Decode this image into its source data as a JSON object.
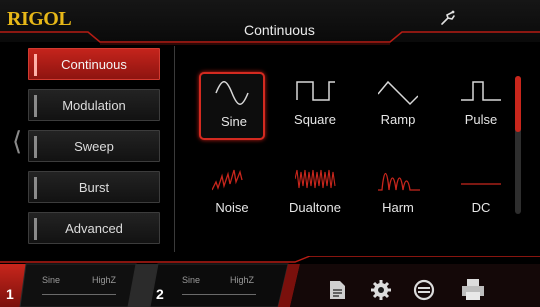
{
  "header": {
    "logo": "RIGOL",
    "title": "Continuous",
    "usb_icon": "usb-icon"
  },
  "menu": {
    "items": [
      {
        "label": "Continuous",
        "active": true
      },
      {
        "label": "Modulation",
        "active": false
      },
      {
        "label": "Sweep",
        "active": false
      },
      {
        "label": "Burst",
        "active": false
      },
      {
        "label": "Advanced",
        "active": false
      }
    ],
    "back_icon": "chevron-left-icon"
  },
  "waveforms": [
    {
      "label": "Sine",
      "icon": "sine-wave-icon",
      "selected": true
    },
    {
      "label": "Square",
      "icon": "square-wave-icon",
      "selected": false
    },
    {
      "label": "Ramp",
      "icon": "ramp-wave-icon",
      "selected": false
    },
    {
      "label": "Pulse",
      "icon": "pulse-wave-icon",
      "selected": false
    },
    {
      "label": "Noise",
      "icon": "noise-wave-icon",
      "selected": false
    },
    {
      "label": "Dualtone",
      "icon": "dualtone-wave-icon",
      "selected": false
    },
    {
      "label": "Harm",
      "icon": "harmonic-wave-icon",
      "selected": false
    },
    {
      "label": "DC",
      "icon": "dc-wave-icon",
      "selected": false
    }
  ],
  "scroll_position": 0.4,
  "channels": [
    {
      "number": "1",
      "waveform": "Sine",
      "impedance": "HighZ",
      "active": true
    },
    {
      "number": "2",
      "waveform": "Sine",
      "impedance": "HighZ",
      "active": false
    }
  ],
  "footer_icons": [
    "document-icon",
    "gear-icon",
    "sync-icon",
    "printer-icon"
  ],
  "colors": {
    "accent": "#c8261c",
    "logo": "#e8b818",
    "background": "#000000"
  }
}
